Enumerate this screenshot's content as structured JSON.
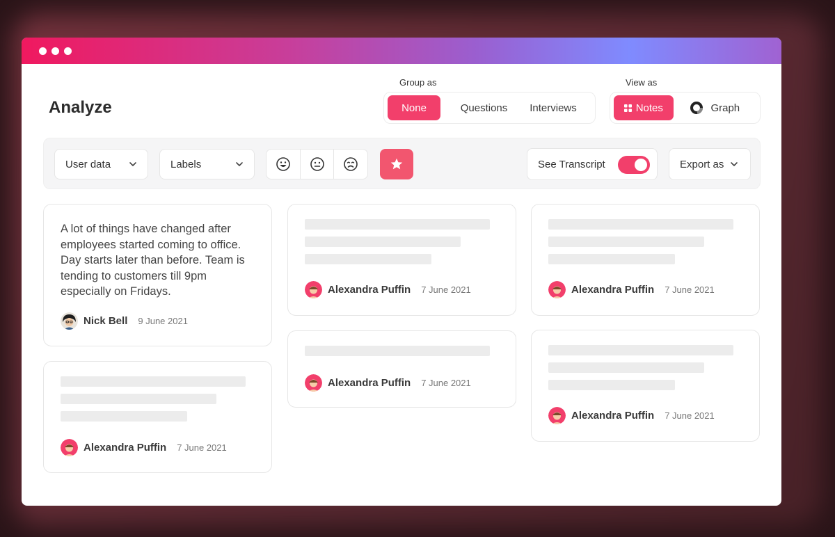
{
  "page": {
    "title": "Analyze"
  },
  "group_as": {
    "label": "Group as",
    "options": [
      "None",
      "Questions",
      "Interviews"
    ],
    "selected": "None"
  },
  "view_as": {
    "label": "View as",
    "options": [
      {
        "label": "Notes",
        "icon": "grid-icon"
      },
      {
        "label": "Graph",
        "icon": "ring-icon"
      }
    ],
    "selected": "Notes"
  },
  "filters": {
    "user_data": "User data",
    "labels": "Labels",
    "sentiments": [
      "happy-face-icon",
      "neutral-face-icon",
      "sad-face-icon"
    ],
    "starred": true
  },
  "transcript": {
    "label": "See Transcript",
    "enabled": true
  },
  "export": {
    "label": "Export as"
  },
  "colors": {
    "accent": "#f23f6b",
    "star": "#f2566f",
    "skeleton": "#ececec"
  },
  "notes": [
    {
      "text": "A lot of things have changed after employees started coming to office. Day starts later than before. Team is tending to customers till 9pm especially on Fridays.",
      "author": "Nick Bell",
      "date": "9 June 2021"
    },
    {
      "author": "Alexandra Puffin",
      "date": "7 June 2021"
    },
    {
      "author": "Alexandra Puffin",
      "date": "7 June 2021"
    },
    {
      "author": "Alexandra Puffin",
      "date": "7 June 2021"
    },
    {
      "author": "Alexandra Puffin",
      "date": "7 June 2021"
    },
    {
      "author": "Alexandra Puffin",
      "date": "7 June 2021"
    }
  ]
}
